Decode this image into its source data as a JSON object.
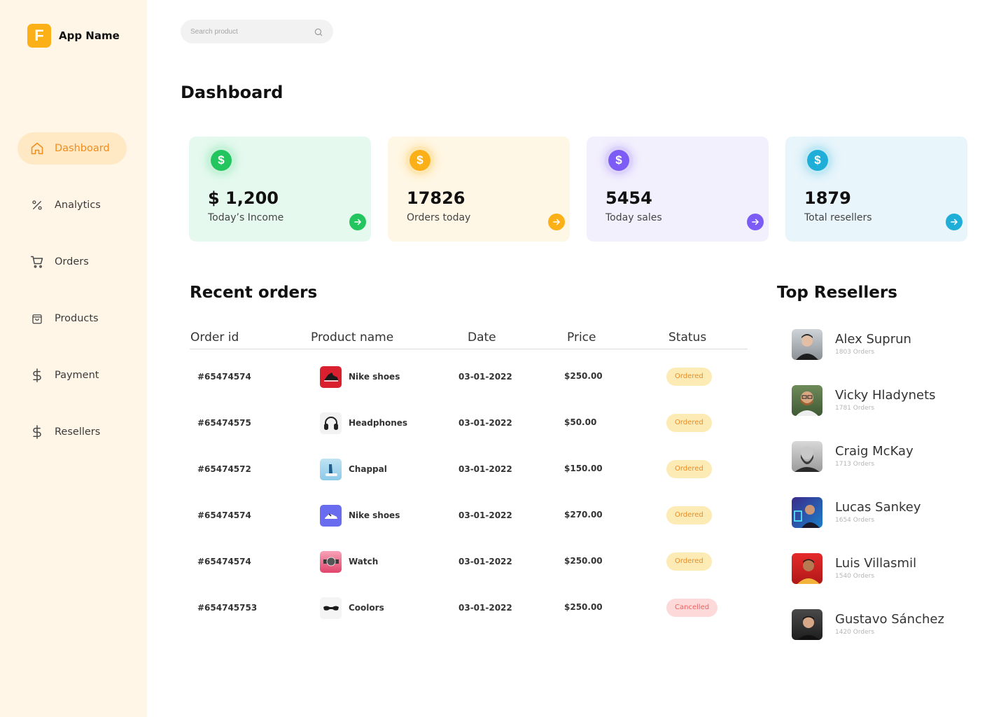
{
  "brand": {
    "logo_letter": "F",
    "name": "App Name",
    "color": "#FBB018"
  },
  "sidebar": {
    "items": [
      {
        "label": "Dashboard",
        "icon": "home-icon",
        "active": true
      },
      {
        "label": "Analytics",
        "icon": "percent-icon"
      },
      {
        "label": "Orders",
        "icon": "cart-icon"
      },
      {
        "label": "Products",
        "icon": "bag-icon"
      },
      {
        "label": "Payment",
        "icon": "dollar-icon"
      },
      {
        "label": "Resellers",
        "icon": "dollar-icon"
      }
    ],
    "active_color": "#F28C1B"
  },
  "search": {
    "placeholder": "Search product"
  },
  "page_title": "Dashboard",
  "stats": [
    {
      "value": "$ 1,200",
      "label": "Today’s Income",
      "accent": "#22C55E",
      "bg": "#E6F9EF"
    },
    {
      "value": "17826",
      "label": "Orders today",
      "accent": "#FBB018",
      "bg": "#FFF7E5"
    },
    {
      "value": "5454",
      "label": "Today sales",
      "accent": "#7C5CF5",
      "bg": "#F3F0FD"
    },
    {
      "value": "1879",
      "label": "Total resellers",
      "accent": "#1EAED8",
      "bg": "#E8F5FB"
    }
  ],
  "recent_orders": {
    "title": "Recent orders",
    "columns": [
      "Order id",
      "Product name",
      "Date",
      "Price",
      "Status"
    ],
    "rows": [
      {
        "id": "#65474574",
        "product": "Nike shoes",
        "date": "03-01-2022",
        "price": "$250.00",
        "status": "Ordered"
      },
      {
        "id": "#65474575",
        "product": "Headphones",
        "date": "03-01-2022",
        "price": "$50.00",
        "status": "Ordered"
      },
      {
        "id": "#65474572",
        "product": "Chappal",
        "date": "03-01-2022",
        "price": "$150.00",
        "status": "Ordered"
      },
      {
        "id": "#65474574",
        "product": "Nike shoes",
        "date": "03-01-2022",
        "price": "$270.00",
        "status": "Ordered"
      },
      {
        "id": "#65474574",
        "product": "Watch",
        "date": "03-01-2022",
        "price": "$250.00",
        "status": "Ordered"
      },
      {
        "id": "#654745753",
        "product": "Coolors",
        "date": "03-01-2022",
        "price": "$250.00",
        "status": "Cancelled"
      }
    ]
  },
  "top_resellers": {
    "title": "Top Resellers",
    "items": [
      {
        "name": "Alex Suprun",
        "orders": "1803 Orders"
      },
      {
        "name": "Vicky Hladynets",
        "orders": "1781 Orders"
      },
      {
        "name": "Craig McKay",
        "orders": "1713 Orders"
      },
      {
        "name": "Lucas Sankey",
        "orders": "1654 Orders"
      },
      {
        "name": "Luis Villasmil",
        "orders": "1540 Orders"
      },
      {
        "name": "Gustavo Sánchez",
        "orders": "1420 Orders"
      }
    ]
  }
}
